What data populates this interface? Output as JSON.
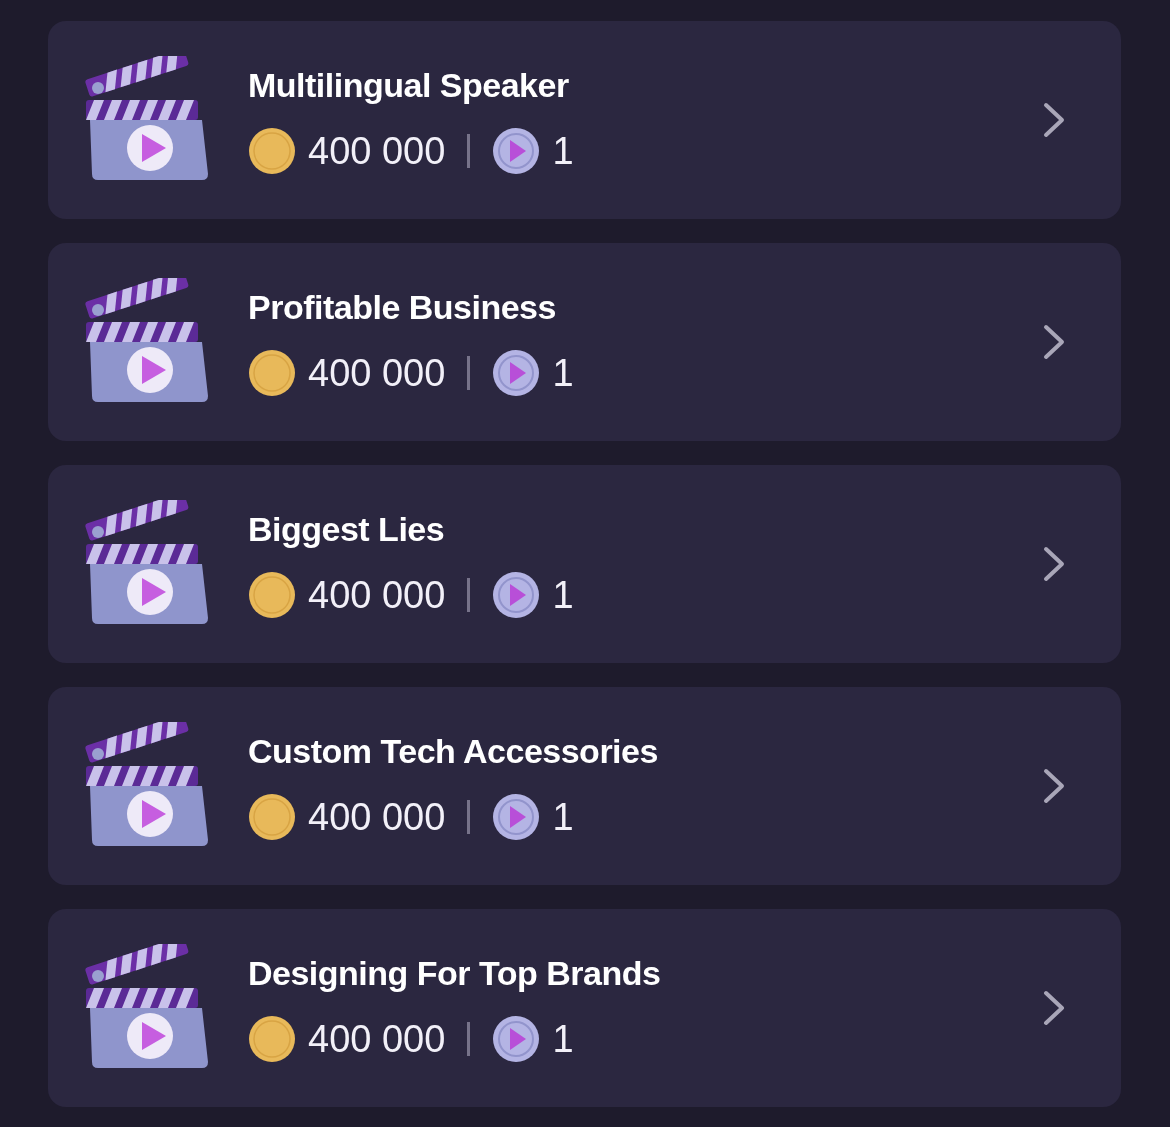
{
  "items": [
    {
      "title": "Multilingual Speaker",
      "coins": "400 000",
      "tickets": "1"
    },
    {
      "title": "Profitable Business",
      "coins": "400 000",
      "tickets": "1"
    },
    {
      "title": "Biggest Lies",
      "coins": "400 000",
      "tickets": "1"
    },
    {
      "title": "Custom Tech Accessories",
      "coins": "400 000",
      "tickets": "1"
    },
    {
      "title": "Designing For Top Brands",
      "coins": "400 000",
      "tickets": "1"
    }
  ]
}
